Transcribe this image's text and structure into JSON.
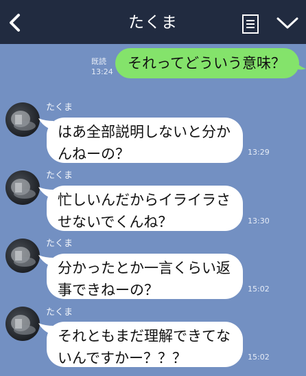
{
  "header": {
    "title": "たくま",
    "back_icon": "chevron-left-icon",
    "notes_icon": "notes-icon",
    "menu_icon": "chevron-down-icon"
  },
  "colors": {
    "header_bg": "#212b40",
    "chat_bg": "#7390c2",
    "sent_bubble": "#84e36b",
    "received_bubble": "#ffffff"
  },
  "sent_message": {
    "text": "それってどういう意味？",
    "read_label": "既読",
    "time": "13:24"
  },
  "received_messages": [
    {
      "sender": "たくま",
      "line1": "はあ全部説明しないと分か",
      "line2": "んねーの？",
      "time": "13:29"
    },
    {
      "sender": "たくま",
      "line1": "忙しいんだからイライラさ",
      "line2": "せないでくんね？",
      "time": "13:30"
    },
    {
      "sender": "たくま",
      "line1": "分かったとか一言くらい返",
      "line2": "事できねーの？",
      "time": "15:02"
    },
    {
      "sender": "たくま",
      "line1": "それともまだ理解できてな",
      "line2": "いんですかー？？？",
      "time": "15:02"
    }
  ]
}
